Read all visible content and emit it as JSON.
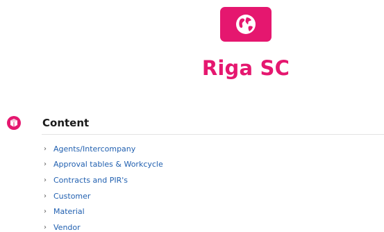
{
  "site": {
    "title": "Riga SC",
    "logo_icon": "globe-icon",
    "accent_color": "#e5176f"
  },
  "section": {
    "title": "Content",
    "icon": "cube-icon",
    "items": [
      {
        "label": "Agents/Intercompany"
      },
      {
        "label": "Approval tables & Workcycle"
      },
      {
        "label": "Contracts and PIR's"
      },
      {
        "label": "Customer"
      },
      {
        "label": "Material"
      },
      {
        "label": "Vendor"
      }
    ]
  }
}
